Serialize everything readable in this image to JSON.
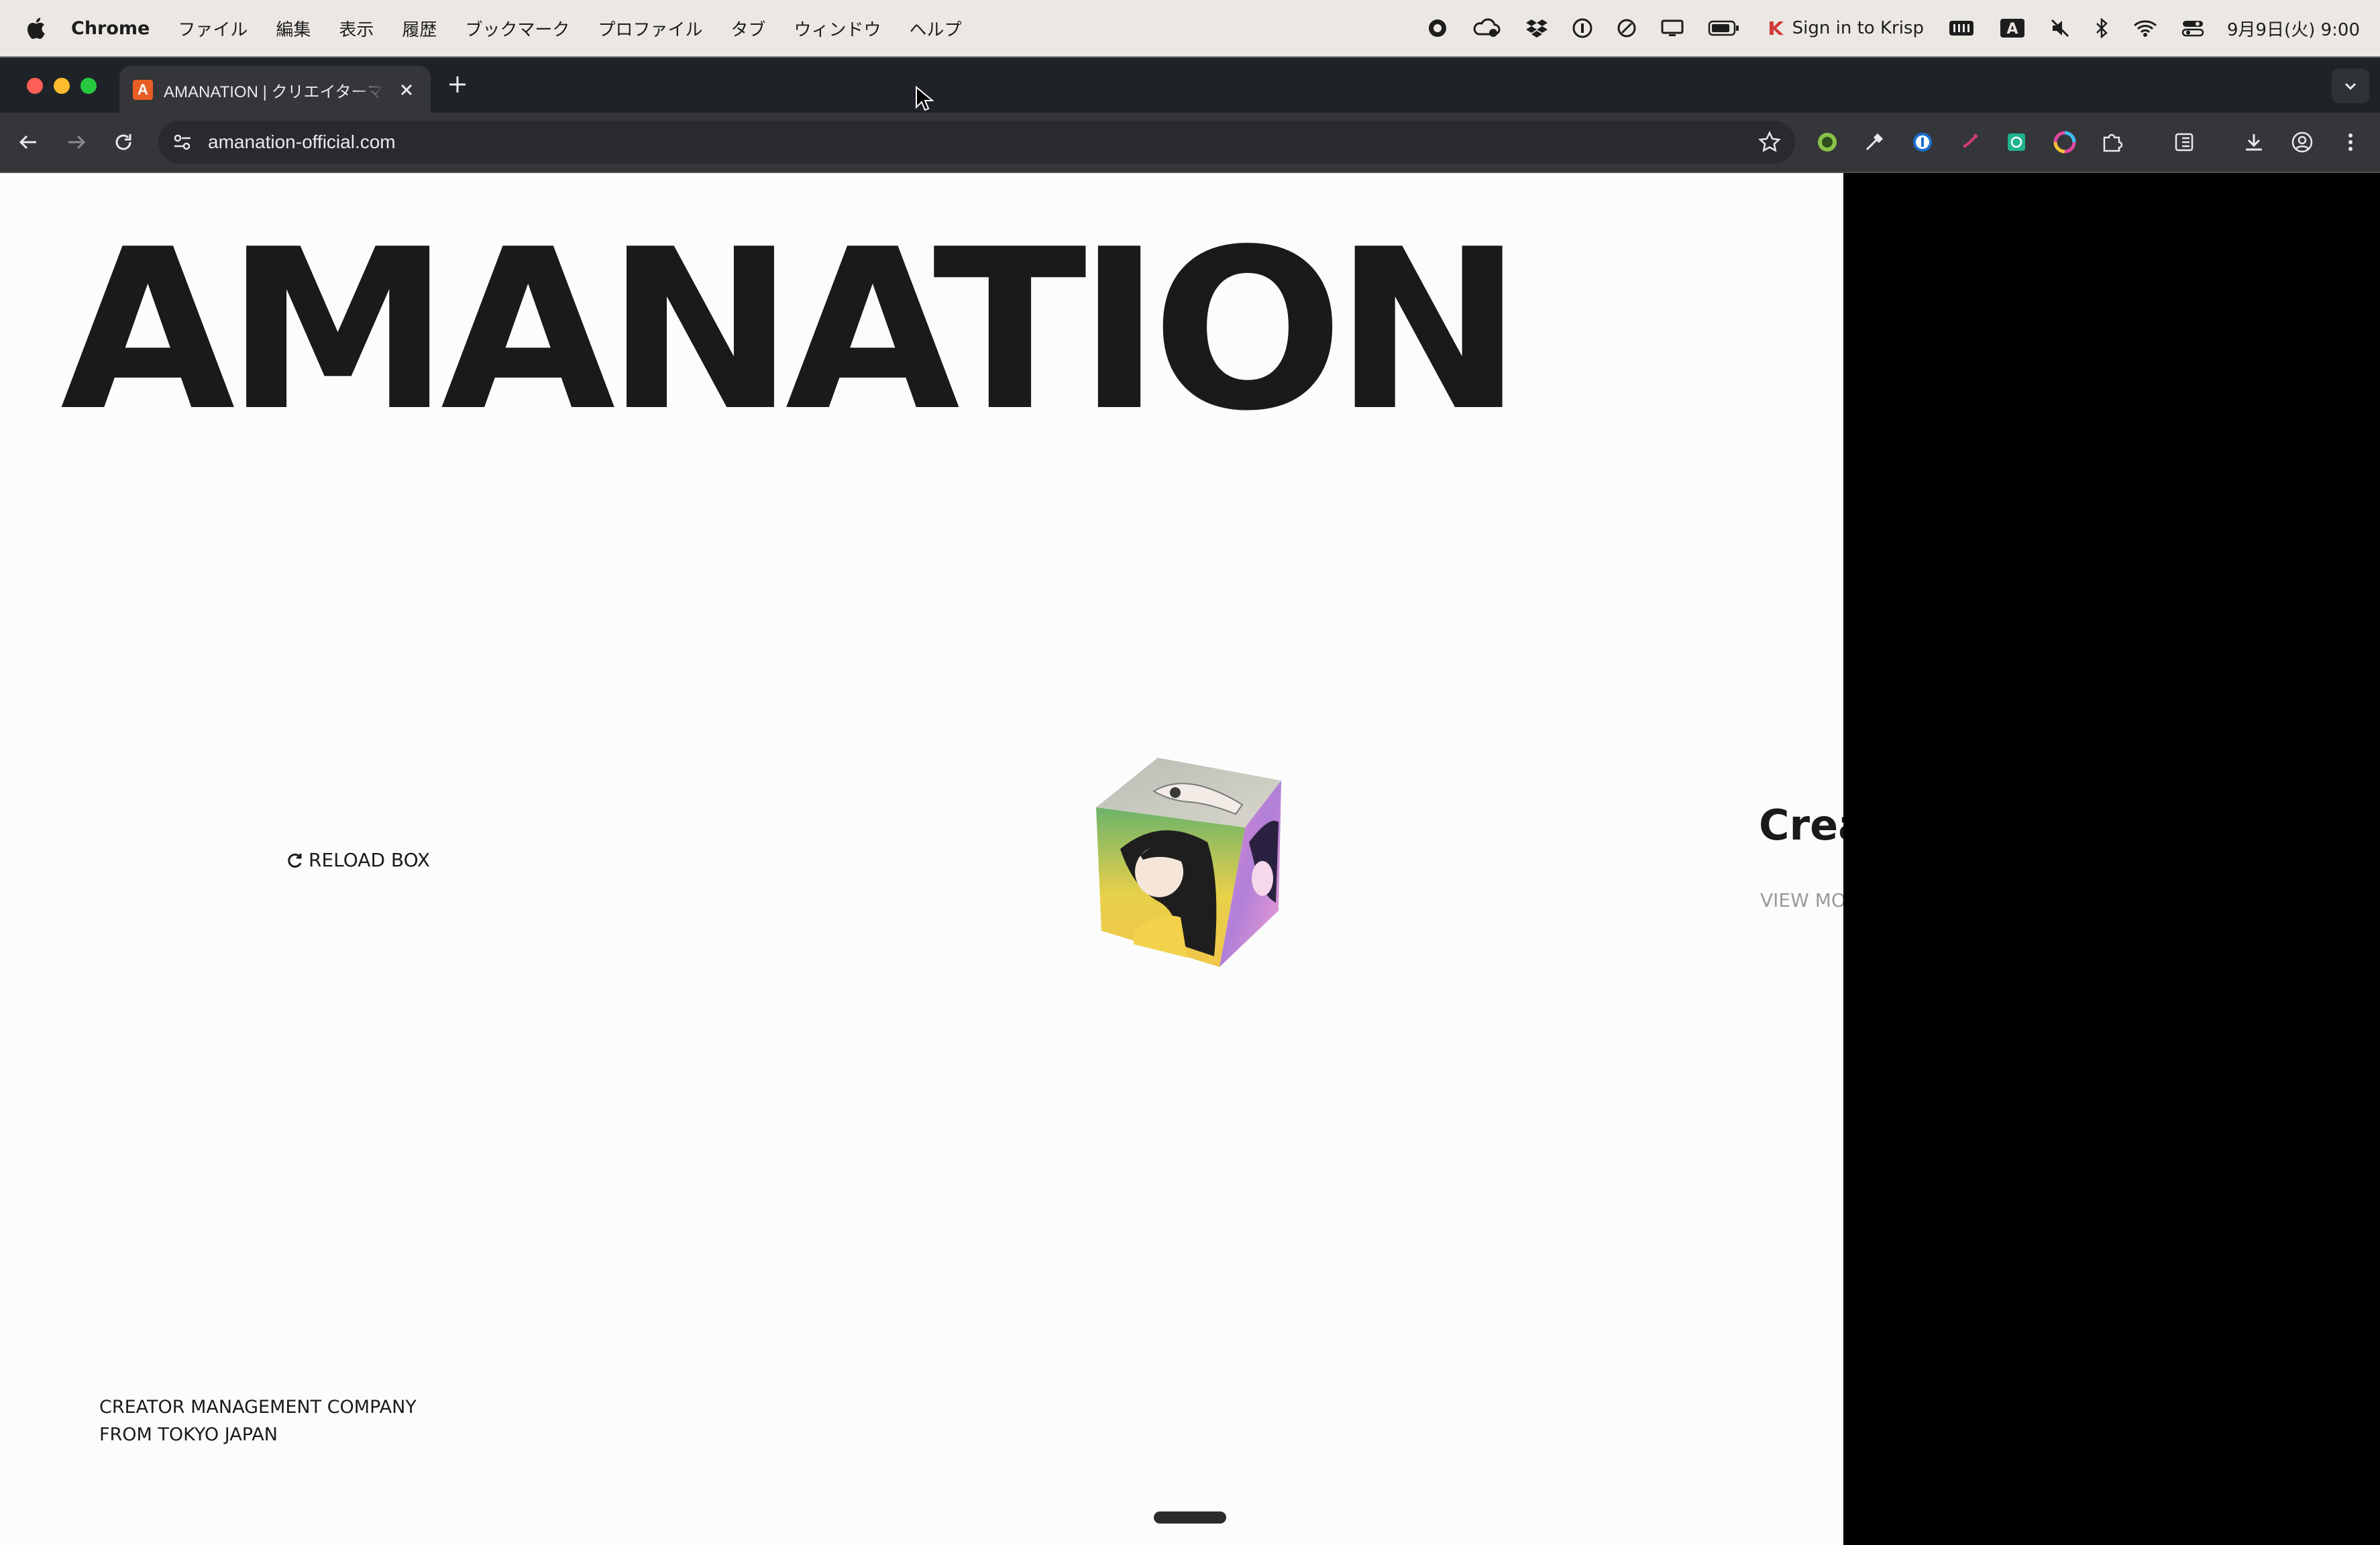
{
  "menubar": {
    "app_name": "Chrome",
    "menu_items": [
      "ファイル",
      "編集",
      "表示",
      "履歴",
      "ブックマーク",
      "プロファイル",
      "タブ",
      "ウィンドウ",
      "ヘルプ"
    ],
    "krisp_label": "Sign in to Krisp",
    "clock": "9月9日(火)  9:00"
  },
  "browser": {
    "tab_title": "AMANATION | クリエイターマネジメント",
    "favicon_letter": "A",
    "url": "amanation-official.com"
  },
  "page": {
    "title": "AMANATION",
    "reload_label": "RELOAD BOX",
    "side_heading": "Crea",
    "side_link": "VIEW MO",
    "tagline_line1": "CREATOR MANAGEMENT COMPANY",
    "tagline_line2": "FROM TOKYO JAPAN"
  },
  "colors": {
    "menubar_bg": "#ebe8e4",
    "tabstrip_bg": "#1f2328",
    "toolbar_bg": "#35363a",
    "page_bg": "#fcfcfc",
    "title_color": "#1a1a1a",
    "favicon_bg": "#e85d24"
  }
}
